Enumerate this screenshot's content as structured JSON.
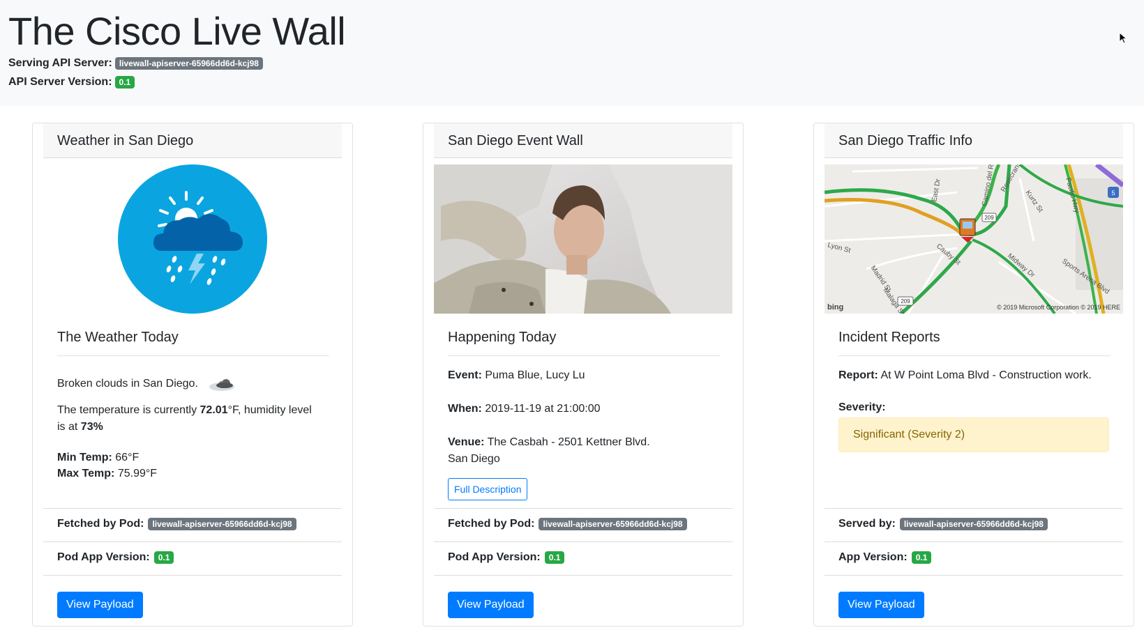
{
  "header": {
    "title": "The Cisco Live Wall",
    "serving_label": "Serving API Server:",
    "serving_value": "livewall-apiserver-65966dd6d-kcj98",
    "version_label": "API Server Version:",
    "version_value": "0.1"
  },
  "weather": {
    "title": "Weather in San Diego",
    "icon": "thunderstorm-cloud-sun-icon",
    "subtitle": "The Weather Today",
    "summary": "Broken clouds in San Diego.",
    "summary_icon": "broken-clouds-icon",
    "temp_prefix": "The temperature is currently ",
    "temp_value": "72.01",
    "temp_unit": "°F, humidity level is at ",
    "humidity": "73%",
    "min_label": "Min Temp:",
    "min_value": "66°F",
    "max_label": "Max Temp:",
    "max_value": "75.99°F",
    "fetched_label": "Fetched by Pod:",
    "fetched_value": "livewall-apiserver-65966dd6d-kcj98",
    "version_label": "Pod App Version:",
    "version_value": "0.1",
    "button": "View Payload"
  },
  "events": {
    "title": "San Diego Event Wall",
    "photo": "event-artist-photo",
    "subtitle": "Happening Today",
    "event_label": "Event:",
    "event_value": "Puma Blue, Lucy Lu",
    "when_label": "When:",
    "when_value": "2019-11-19 at 21:00:00",
    "venue_label": "Venue:",
    "venue_value": "The Casbah - 2501 Kettner Blvd.",
    "venue_city": "San Diego",
    "description_button": "Full Description",
    "fetched_label": "Fetched by Pod:",
    "fetched_value": "livewall-apiserver-65966dd6d-kcj98",
    "version_label": "Pod App Version:",
    "version_value": "0.1",
    "button": "View Payload"
  },
  "traffic": {
    "title": "San Diego Traffic Info",
    "map": {
      "streets": [
        "Camino del Rio",
        "Rosecrans St",
        "Kurtz St",
        "Pacific Hwy",
        "Lyon St",
        "Cauby St",
        "Midway Dr",
        "Madrid St",
        "Malaga St",
        "Sports Arena Blvd",
        "East Dr"
      ],
      "route_shields": [
        "209",
        "209",
        "5"
      ],
      "brand": "bing",
      "copyright": "© 2019 Microsoft Corporation © 2019 HERE"
    },
    "subtitle": "Incident Reports",
    "report_label": "Report:",
    "report_value": "At W Point Loma Blvd - Construction work.",
    "severity_label": "Severity:",
    "severity_value": "Significant (Severity 2)",
    "served_label": "Served by:",
    "served_value": "livewall-apiserver-65966dd6d-kcj98",
    "version_label": "App Version:",
    "version_value": "0.1",
    "button": "View Payload"
  }
}
